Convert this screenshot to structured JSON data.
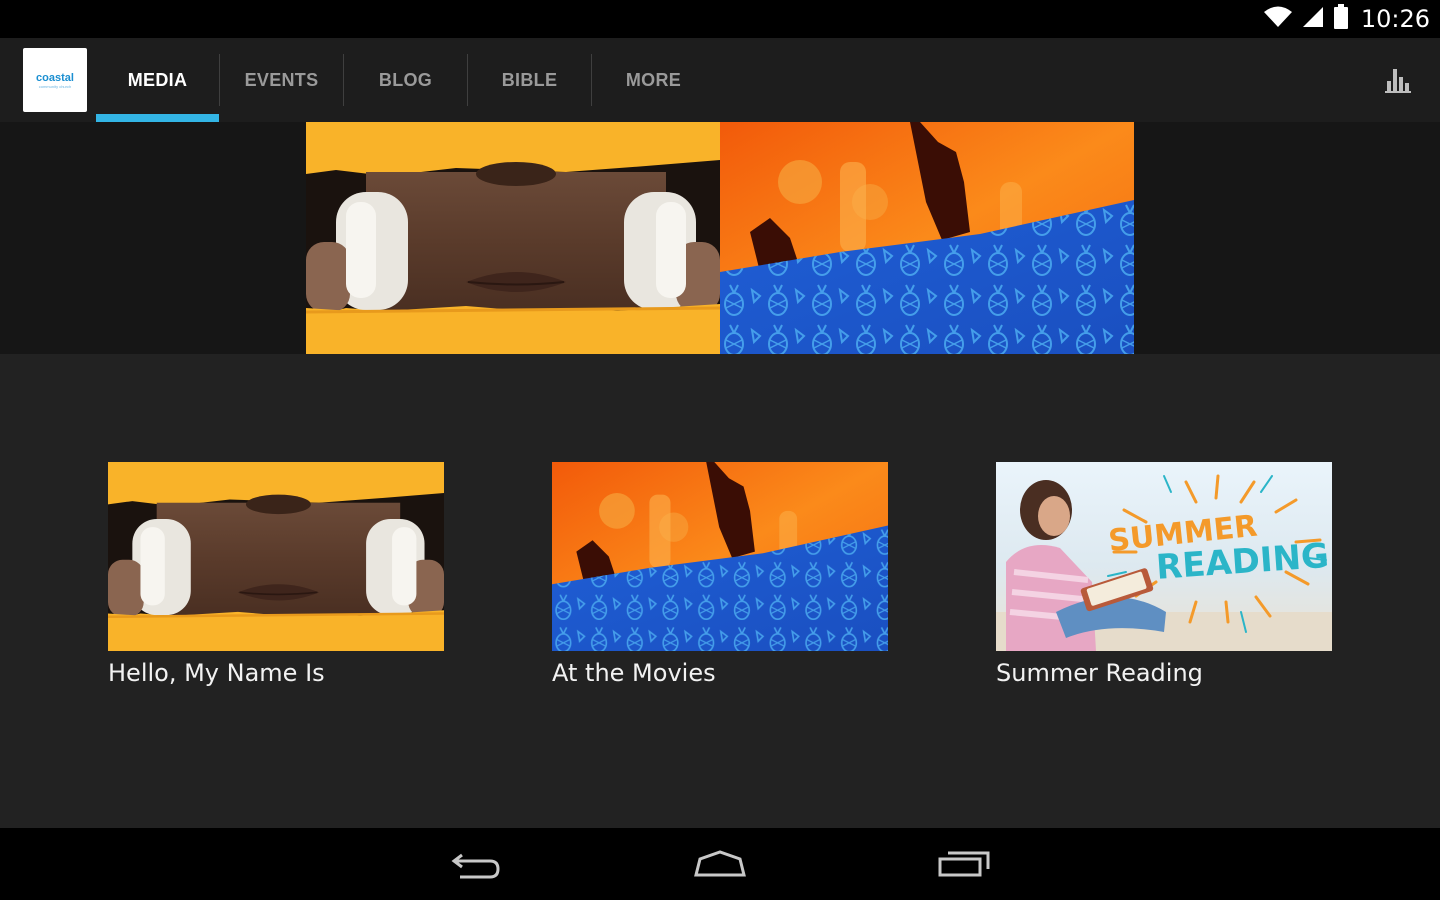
{
  "status_bar": {
    "time": "10:26",
    "icons": [
      "wifi-icon",
      "cell-signal-icon",
      "battery-icon"
    ]
  },
  "action_bar": {
    "logo": {
      "text": "coastal",
      "subtext": "community church"
    },
    "tabs": [
      {
        "label": "MEDIA",
        "active": true
      },
      {
        "label": "EVENTS",
        "active": false
      },
      {
        "label": "BLOG",
        "active": false
      },
      {
        "label": "BIBLE",
        "active": false
      },
      {
        "label": "MORE",
        "active": false
      }
    ],
    "action_icon": "bar-chart-icon",
    "accent_color": "#33b5e5"
  },
  "hero": {
    "images": [
      "hello-my-name-is-banner",
      "at-the-movies-banner"
    ]
  },
  "media_items": [
    {
      "title": "Hello, My Name Is",
      "thumbnail": "headphones-photo"
    },
    {
      "title": "At the Movies",
      "thumbnail": "concert-crowd-photo"
    },
    {
      "title": "Summer Reading",
      "thumbnail": "woman-reading-on-beach-photo",
      "thumbnail_text": [
        "SUMMER",
        "READING"
      ]
    }
  ],
  "nav_bar": {
    "icons": [
      "back-icon",
      "home-icon",
      "recent-apps-icon"
    ]
  }
}
